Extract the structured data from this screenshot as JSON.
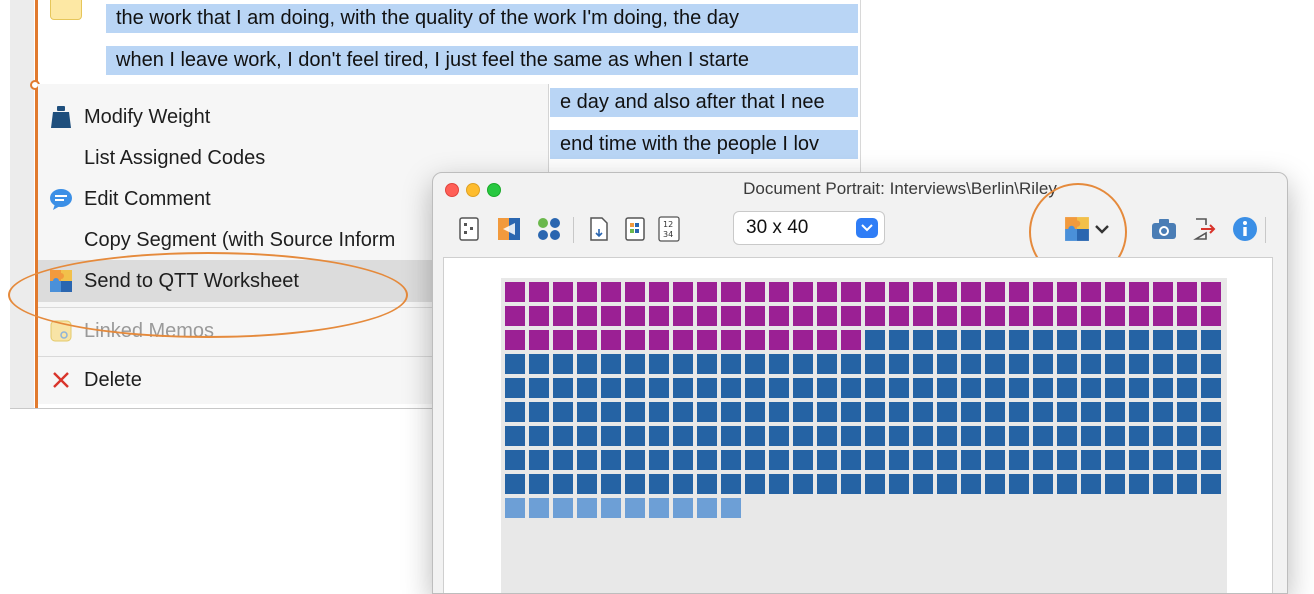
{
  "document": {
    "lines": [
      "the work that I am doing, with the quality of the work I'm doing, the day",
      "when I leave work, I don't feel tired, I just feel the same as when I starte",
      "e day and also after that I nee",
      "end time with the people I lov"
    ]
  },
  "context_menu": {
    "items": [
      {
        "label": "Modify Weight",
        "icon": "weight-icon",
        "enabled": true
      },
      {
        "label": "List Assigned Codes",
        "icon": "",
        "enabled": true
      },
      {
        "label": "Edit Comment",
        "icon": "comment-bubble-icon",
        "enabled": true
      },
      {
        "label": "Copy Segment (with Source Inform",
        "icon": "",
        "enabled": true
      },
      {
        "label": "Send to QTT Worksheet",
        "icon": "qtt-puzzle-icon",
        "enabled": true,
        "highlighted": true
      },
      {
        "label": "Linked Memos",
        "icon": "memo-icon",
        "enabled": false
      },
      {
        "label": "Delete",
        "icon": "delete-x-icon",
        "enabled": true
      }
    ]
  },
  "portrait_window": {
    "title": "Document Portrait: Interviews\\Berlin\\Riley",
    "grid_size": "30 x 40",
    "colors": {
      "purple": "#9b2094",
      "dark_blue": "#2563a4",
      "light_blue": "#6d9fd6"
    },
    "cell_counts": {
      "purple": 75,
      "dark_blue": 195,
      "light_blue": 10
    }
  }
}
